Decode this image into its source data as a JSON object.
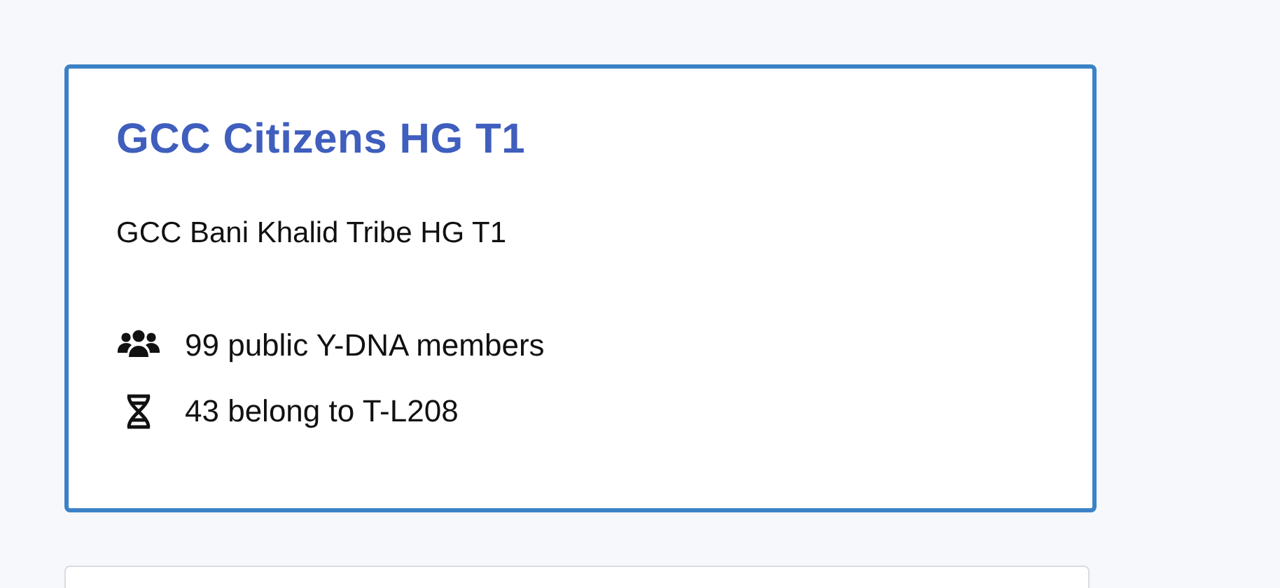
{
  "cards": [
    {
      "selected": true,
      "title": "GCC Citizens HG T1",
      "description": "GCC Bani Khalid Tribe HG T1",
      "stats": [
        {
          "kind": "members",
          "text": "99 public Y-DNA members"
        },
        {
          "kind": "dna",
          "text": "43 belong to T-L208"
        }
      ]
    },
    {
      "selected": false
    }
  ]
}
